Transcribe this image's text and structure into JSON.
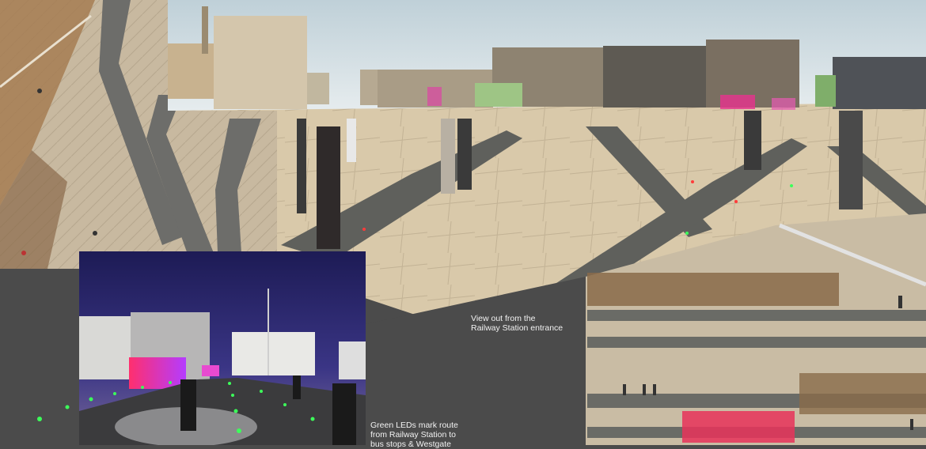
{
  "captions": {
    "station_view": {
      "line1": "View out from the",
      "line2": "Railway Station entrance"
    },
    "green_leds": {
      "line1": "Green LEDs mark route",
      "line2": "from Railway Station to",
      "line3": "bus stops & Westgate"
    }
  },
  "colors": {
    "background_panel": "#4b4b4b",
    "paving_light": "#d8c7a8",
    "paving_granite": "#6f6f6a",
    "sky": "#c9d6db",
    "night_sky": "#2b2a6e",
    "led_green": "#3cff5a",
    "light_wall_magenta": "#e8328f"
  }
}
